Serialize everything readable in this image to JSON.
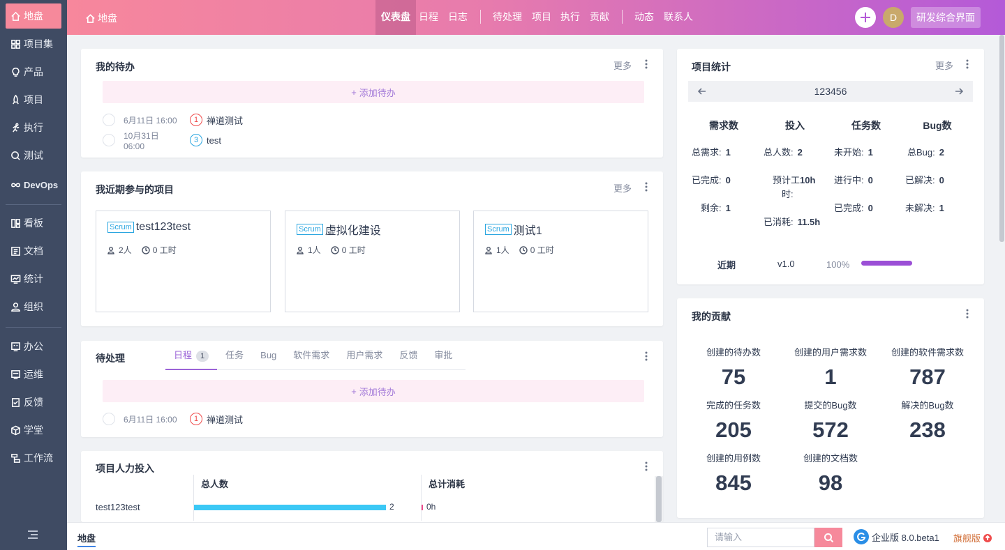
{
  "sidebar": {
    "items": [
      {
        "label": "地盘",
        "icon": "home-icon",
        "active": true
      },
      {
        "label": "项目集",
        "icon": "grid-icon"
      },
      {
        "label": "产品",
        "icon": "lightbulb-icon"
      },
      {
        "label": "项目",
        "icon": "rocket-icon"
      },
      {
        "label": "执行",
        "icon": "run-icon"
      },
      {
        "label": "测试",
        "icon": "test-icon"
      },
      {
        "label": "DevOps",
        "icon": "infinity-icon"
      },
      {
        "label": "看板",
        "icon": "kanban-icon"
      },
      {
        "label": "文档",
        "icon": "document-icon"
      },
      {
        "label": "统计",
        "icon": "chart-icon"
      },
      {
        "label": "组织",
        "icon": "user-icon"
      },
      {
        "label": "办公",
        "icon": "office-icon"
      },
      {
        "label": "运维",
        "icon": "ops-icon"
      },
      {
        "label": "反馈",
        "icon": "feedback-icon"
      },
      {
        "label": "学堂",
        "icon": "cube-icon"
      },
      {
        "label": "工作流",
        "icon": "workflow-icon"
      }
    ]
  },
  "header": {
    "breadcrumb": "地盘",
    "nav": {
      "dashboard": "仪表盘",
      "calendar": "日程",
      "log": "日志",
      "pending": "待处理",
      "project": "项目",
      "execution": "执行",
      "contribution": "贡献",
      "dynamic": "动态",
      "contacts": "联系人"
    },
    "avatar_letter": "D",
    "app_switch": "研发综合界面"
  },
  "todo_panel": {
    "title": "我的待办",
    "more": "更多",
    "add_label": "添加待办",
    "items": [
      {
        "date": "6月11日 16:00",
        "priority": "1",
        "name": "禅道测试"
      },
      {
        "date": "10月31日 06:00",
        "priority": "3",
        "name": "test"
      }
    ]
  },
  "projects_panel": {
    "title": "我近期参与的项目",
    "more": "更多",
    "cards": [
      {
        "tag": "Scrum",
        "name": "test123test",
        "people": "2人",
        "hours": "0 工时"
      },
      {
        "tag": "Scrum",
        "name": "虚拟化建设",
        "people": "1人",
        "hours": "0 工时"
      },
      {
        "tag": "Scrum",
        "name": "测试1",
        "people": "1人",
        "hours": "0 工时"
      }
    ]
  },
  "pending_panel": {
    "title": "待处理",
    "tabs": [
      "日程",
      "任务",
      "Bug",
      "软件需求",
      "用户需求",
      "反馈",
      "审批"
    ],
    "calendar_count": "1",
    "add_label": "添加待办",
    "items": [
      {
        "date": "6月11日 16:00",
        "priority": "1",
        "name": "禅道测试"
      }
    ]
  },
  "manpower_panel": {
    "title": "项目人力投入",
    "col_people": "总人数",
    "col_consume": "总计消耗",
    "rows": [
      {
        "name": "test123test",
        "people": "2",
        "consume": "0h",
        "people_fraction": 1.0
      }
    ]
  },
  "stats_panel": {
    "title": "项目统计",
    "more": "更多",
    "project_name": "123456",
    "headers": [
      "需求数",
      "投入",
      "任务数",
      "Bug数"
    ],
    "req": {
      "total_label": "总需求:",
      "total": "1",
      "done_label": "已完成:",
      "done": "0",
      "left_label": "剩余:",
      "left": "1"
    },
    "invest": {
      "people_label": "总人数:",
      "people": "2",
      "est_label_a": "预计工",
      "est_label_b": "时:",
      "est": "10h",
      "consumed_label": "已消耗:",
      "consumed": "11.5h"
    },
    "task": {
      "wait_label": "未开始:",
      "wait": "1",
      "doing_label": "进行中:",
      "doing": "0",
      "done_label": "已完成:",
      "done": "0"
    },
    "bug": {
      "total_label": "总Bug:",
      "total": "2",
      "resolved_label": "已解决:",
      "resolved": "0",
      "unresolved_label": "未解决:",
      "unresolved": "1"
    },
    "recent_label": "近期",
    "version": "v1.0",
    "progress": "100%",
    "progress_value": 1.0,
    "progress_color": "#9b4fd6"
  },
  "contrib_panel": {
    "title": "我的贡献",
    "items": [
      {
        "label": "创建的待办数",
        "value": "75"
      },
      {
        "label": "创建的用户需求数",
        "value": "1"
      },
      {
        "label": "创建的软件需求数",
        "value": "787"
      },
      {
        "label": "完成的任务数",
        "value": "205"
      },
      {
        "label": "提交的Bug数",
        "value": "572"
      },
      {
        "label": "解决的Bug数",
        "value": "238"
      },
      {
        "label": "创建的用例数",
        "value": "845"
      },
      {
        "label": "创建的文档数",
        "value": "98"
      }
    ]
  },
  "bottombar": {
    "home": "地盘",
    "search_placeholder": "请输入",
    "edition": "企业版 8.0.beta1",
    "flagship": "旗舰版"
  },
  "colors": {
    "accent": "#f6899b",
    "purple": "#9b63d7",
    "sidebar": "#3f4b63",
    "bar": "#3bc8f5"
  }
}
